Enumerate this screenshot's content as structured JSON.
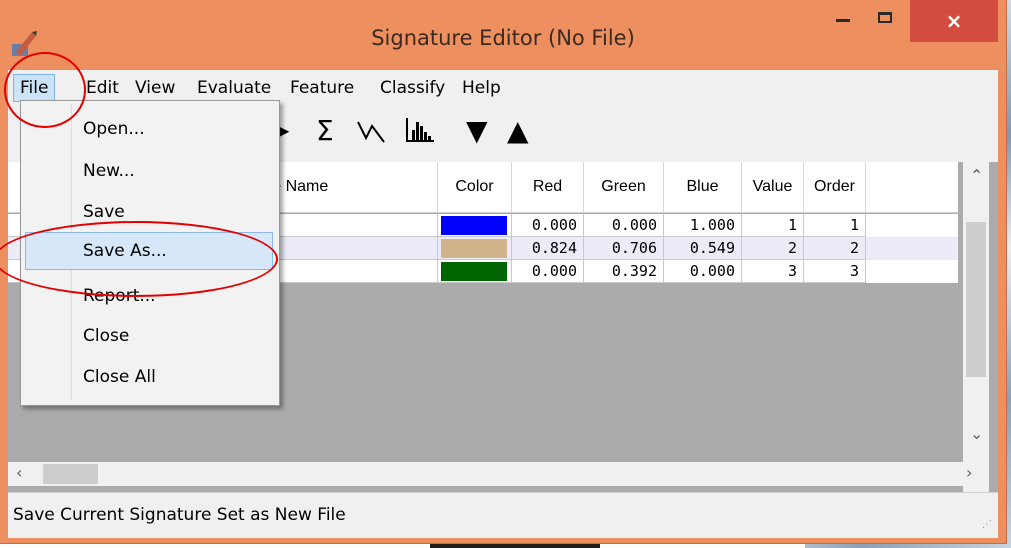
{
  "window": {
    "title": "Signature Editor (No File)",
    "close_glyph": "×"
  },
  "menu": {
    "items": [
      "File",
      "Edit",
      "View",
      "Evaluate",
      "Feature",
      "Classify",
      "Help"
    ]
  },
  "toolbar": {
    "icons": [
      "sigma-icon",
      "lightning-plot-icon",
      "histogram-icon",
      "triangle-down-icon",
      "triangle-up-icon"
    ],
    "sigma": "Σ",
    "down": "▼",
    "up": "▲"
  },
  "file_menu": {
    "items": [
      "Open...",
      "New...",
      "Save",
      "Save As...",
      "Report...",
      "Close",
      "Close All"
    ],
    "highlighted": "Save As..."
  },
  "grid": {
    "headers": [
      "ure Name",
      "Color",
      "Red",
      "Green",
      "Blue",
      "Value",
      "Order"
    ],
    "rows": [
      {
        "color": "#0000ff",
        "red": "0.000",
        "green": "0.000",
        "blue": "1.000",
        "value": "1",
        "order": "1"
      },
      {
        "color": "#d2b48c",
        "red": "0.824",
        "green": "0.706",
        "blue": "0.549",
        "value": "2",
        "order": "2"
      },
      {
        "color": "#006400",
        "red": "0.000",
        "green": "0.392",
        "blue": "0.000",
        "value": "3",
        "order": "3"
      }
    ]
  },
  "status": {
    "text": "Save Current Signature Set as New File"
  },
  "colors": {
    "title_bar": "#ed8f5e",
    "close_button": "#d24d40",
    "annotation_ring": "#e30000"
  }
}
